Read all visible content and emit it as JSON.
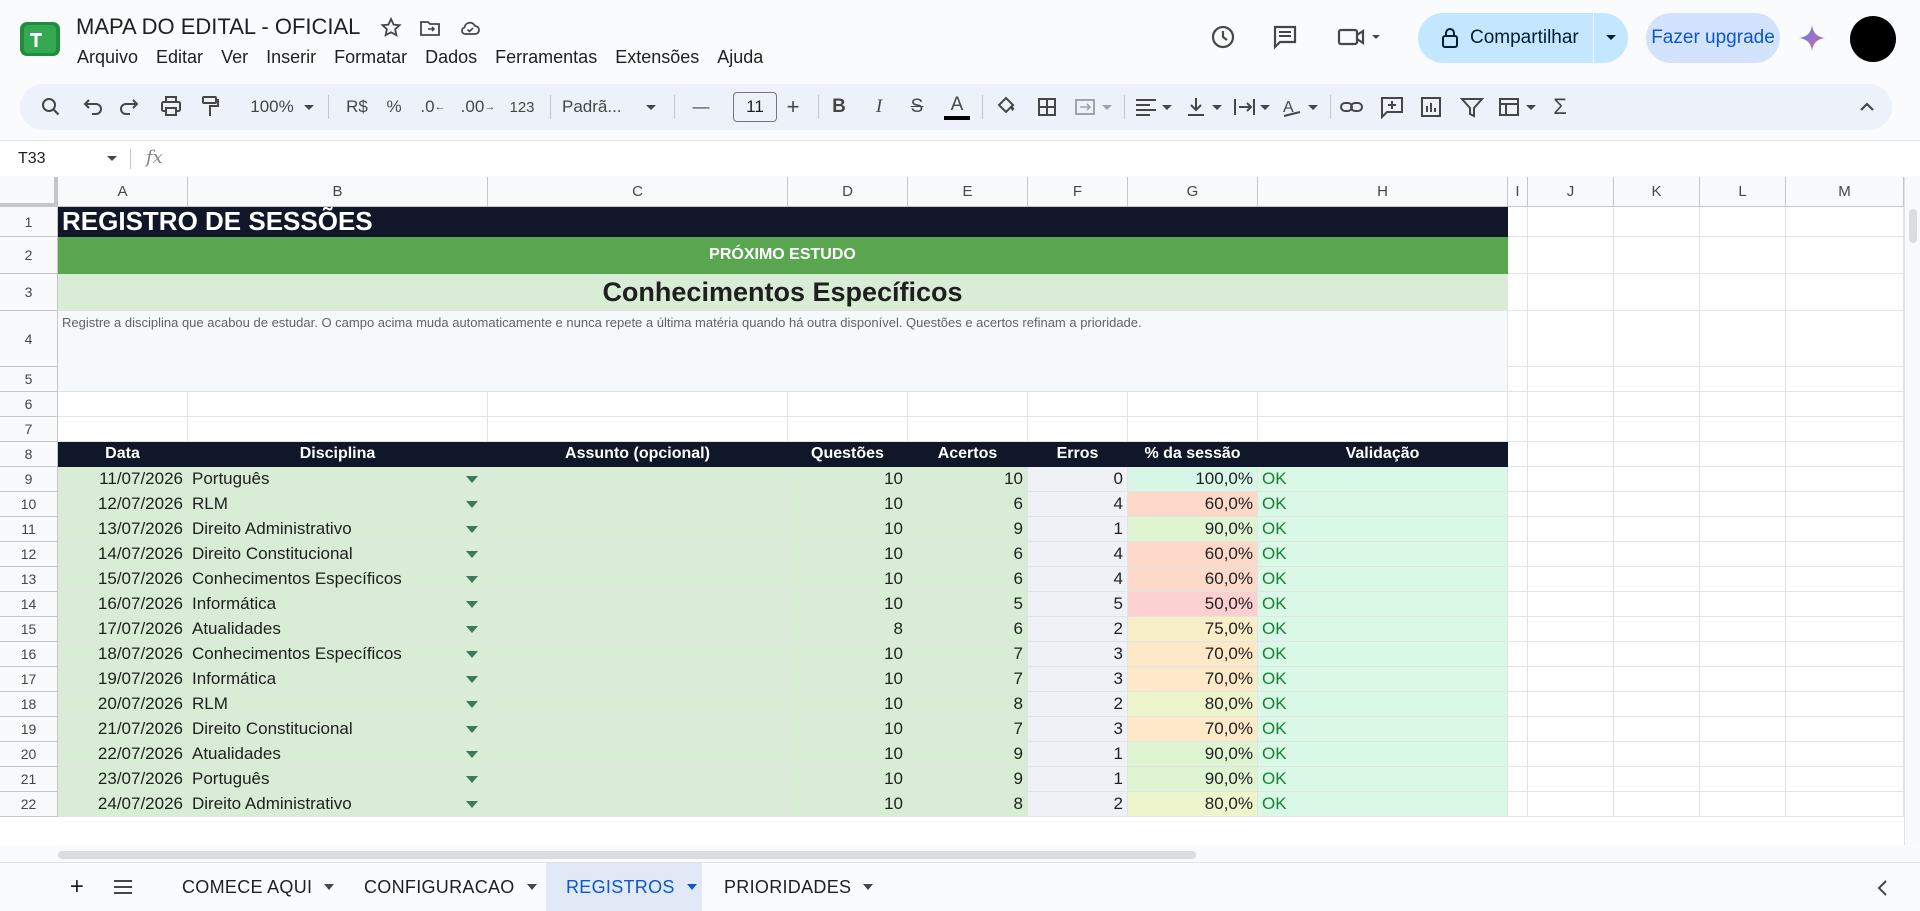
{
  "app": {
    "title": "MAPA DO EDITAL - OFICIAL",
    "menu": [
      "Arquivo",
      "Editar",
      "Ver",
      "Inserir",
      "Formatar",
      "Dados",
      "Ferramentas",
      "Extensões",
      "Ajuda"
    ],
    "share_label": "Compartilhar",
    "upgrade_label": "Fazer upgrade"
  },
  "toolbar": {
    "zoom": "100%",
    "currency": "R$",
    "percent": "%",
    "dec_decrease": ".0",
    "dec_increase": ".00",
    "number_format": "123",
    "font": "Padrã...",
    "font_size": "11",
    "minus": "—",
    "plus": "+",
    "sigma": "Σ"
  },
  "formula_bar": {
    "name_box": "T33",
    "fx": "fx"
  },
  "columns": [
    "A",
    "B",
    "C",
    "D",
    "E",
    "F",
    "G",
    "H",
    "I",
    "J",
    "K",
    "L",
    "M"
  ],
  "rows": [
    "1",
    "2",
    "3",
    "4",
    "5",
    "6",
    "7",
    "8",
    "9",
    "10",
    "11",
    "12",
    "13",
    "14",
    "15",
    "16",
    "17",
    "18",
    "19",
    "20",
    "21",
    "22"
  ],
  "sheet": {
    "title": "REGISTRO DE SESSÕES",
    "next_label": "PRÓXIMO ESTUDO",
    "next_subject": "Conhecimentos Específicos",
    "instructions": "Registre a disciplina que acabou de estudar. O campo acima muda automaticamente e nunca repete a última matéria quando há outra disponível. Questões e acertos refinam a prioridade.",
    "headers": [
      "Data",
      "Disciplina",
      "Assunto (opcional)",
      "Questões",
      "Acertos",
      "Erros",
      "% da sessão",
      "Validação"
    ],
    "records": [
      {
        "data": "11/07/2026",
        "disciplina": "Português",
        "assunto": "",
        "questoes": "10",
        "acertos": "10",
        "erros": "0",
        "pct": "100,0%",
        "validacao": "OK",
        "pct_color": "#d9f7e6"
      },
      {
        "data": "12/07/2026",
        "disciplina": "RLM",
        "assunto": "",
        "questoes": "10",
        "acertos": "6",
        "erros": "4",
        "pct": "60,0%",
        "validacao": "OK",
        "pct_color": "#fcd9c8"
      },
      {
        "data": "13/07/2026",
        "disciplina": "Direito Administrativo",
        "assunto": "",
        "questoes": "10",
        "acertos": "9",
        "erros": "1",
        "pct": "90,0%",
        "validacao": "OK",
        "pct_color": "#dff5d2"
      },
      {
        "data": "14/07/2026",
        "disciplina": "Direito Constitucional",
        "assunto": "",
        "questoes": "10",
        "acertos": "6",
        "erros": "4",
        "pct": "60,0%",
        "validacao": "OK",
        "pct_color": "#fcd9c8"
      },
      {
        "data": "15/07/2026",
        "disciplina": "Conhecimentos Específicos",
        "assunto": "",
        "questoes": "10",
        "acertos": "6",
        "erros": "4",
        "pct": "60,0%",
        "validacao": "OK",
        "pct_color": "#fcd9c8"
      },
      {
        "data": "16/07/2026",
        "disciplina": "Informática",
        "assunto": "",
        "questoes": "10",
        "acertos": "5",
        "erros": "5",
        "pct": "50,0%",
        "validacao": "OK",
        "pct_color": "#fccfd0"
      },
      {
        "data": "17/07/2026",
        "disciplina": "Atualidades",
        "assunto": "",
        "questoes": "8",
        "acertos": "6",
        "erros": "2",
        "pct": "75,0%",
        "validacao": "OK",
        "pct_color": "#f8eec8"
      },
      {
        "data": "18/07/2026",
        "disciplina": "Conhecimentos Específicos",
        "assunto": "",
        "questoes": "10",
        "acertos": "7",
        "erros": "3",
        "pct": "70,0%",
        "validacao": "OK",
        "pct_color": "#fde8c8"
      },
      {
        "data": "19/07/2026",
        "disciplina": "Informática",
        "assunto": "",
        "questoes": "10",
        "acertos": "7",
        "erros": "3",
        "pct": "70,0%",
        "validacao": "OK",
        "pct_color": "#fde8c8"
      },
      {
        "data": "20/07/2026",
        "disciplina": "RLM",
        "assunto": "",
        "questoes": "10",
        "acertos": "8",
        "erros": "2",
        "pct": "80,0%",
        "validacao": "OK",
        "pct_color": "#eef5cc"
      },
      {
        "data": "21/07/2026",
        "disciplina": "Direito Constitucional",
        "assunto": "",
        "questoes": "10",
        "acertos": "7",
        "erros": "3",
        "pct": "70,0%",
        "validacao": "OK",
        "pct_color": "#fde8c8"
      },
      {
        "data": "22/07/2026",
        "disciplina": "Atualidades",
        "assunto": "",
        "questoes": "10",
        "acertos": "9",
        "erros": "1",
        "pct": "90,0%",
        "validacao": "OK",
        "pct_color": "#dff5d2"
      },
      {
        "data": "23/07/2026",
        "disciplina": "Português",
        "assunto": "",
        "questoes": "10",
        "acertos": "9",
        "erros": "1",
        "pct": "90,0%",
        "validacao": "OK",
        "pct_color": "#dff5d2"
      },
      {
        "data": "24/07/2026",
        "disciplina": "Direito Administrativo",
        "assunto": "",
        "questoes": "10",
        "acertos": "8",
        "erros": "2",
        "pct": "80,0%",
        "validacao": "OK",
        "pct_color": "#eef5cc"
      }
    ]
  },
  "tabs": [
    {
      "label": "COMECE AQUI",
      "active": false
    },
    {
      "label": "CONFIGURACAO",
      "active": false
    },
    {
      "label": "REGISTROS",
      "active": true
    },
    {
      "label": "PRIORIDADES",
      "active": false
    }
  ],
  "colors": {
    "title_bg": "#101729",
    "next_bg": "#5aa650",
    "subject_bg": "#d8ecd6",
    "instr_bg": "#f6f9fc",
    "header_bg": "#101729",
    "row_bg": "#d8ecd6",
    "erros_bg": "#eef2f7",
    "valid_bg": "#d9f8e6",
    "ok_color": "#188038"
  }
}
